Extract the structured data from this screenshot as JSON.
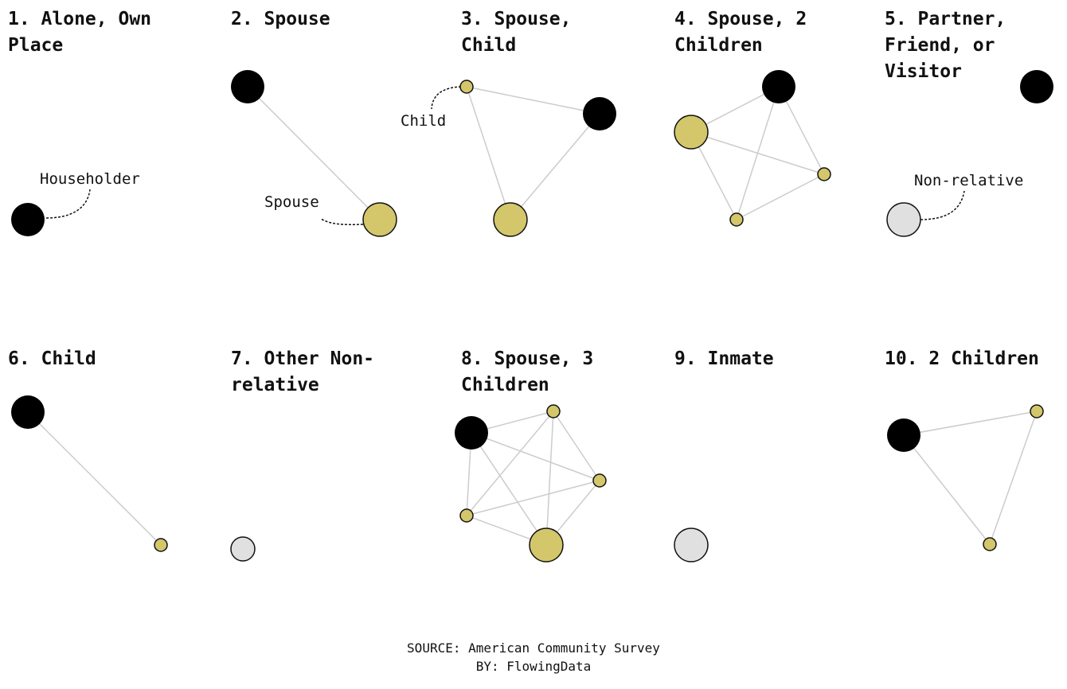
{
  "colors": {
    "householder": "#000000",
    "relative": "#d4c66a",
    "non_relative": "#e0e0e0",
    "stroke": "#111111",
    "edge": "#cccccc"
  },
  "panels": [
    {
      "title": "1. Alone, Own Place",
      "nodes": [
        {
          "role": "householder",
          "size": "large"
        }
      ],
      "edges": [],
      "annotation": {
        "label": "Householder",
        "target_node": 0
      }
    },
    {
      "title": "2. Spouse",
      "nodes": [
        {
          "role": "householder",
          "size": "large"
        },
        {
          "role": "relative",
          "size": "large"
        }
      ],
      "edges": [
        [
          0,
          1
        ]
      ],
      "annotation": {
        "label": "Spouse",
        "target_node": 1
      }
    },
    {
      "title": "3. Spouse, Child",
      "nodes": [
        {
          "role": "relative",
          "size": "small"
        },
        {
          "role": "householder",
          "size": "large"
        },
        {
          "role": "relative",
          "size": "large"
        }
      ],
      "edges": [
        [
          0,
          1
        ],
        [
          0,
          2
        ],
        [
          1,
          2
        ]
      ],
      "annotation": {
        "label": "Child",
        "target_node": 0
      }
    },
    {
      "title": "4. Spouse, 2 Children",
      "nodes": [
        {
          "role": "householder",
          "size": "large"
        },
        {
          "role": "relative",
          "size": "large"
        },
        {
          "role": "relative",
          "size": "small"
        },
        {
          "role": "relative",
          "size": "small"
        }
      ],
      "edges": [
        [
          0,
          1
        ],
        [
          0,
          2
        ],
        [
          0,
          3
        ],
        [
          1,
          2
        ],
        [
          1,
          3
        ],
        [
          2,
          3
        ]
      ],
      "annotation": null
    },
    {
      "title": "5. Partner, Friend, or Visitor",
      "nodes": [
        {
          "role": "householder",
          "size": "large"
        },
        {
          "role": "non_relative",
          "size": "large"
        }
      ],
      "edges": [],
      "annotation": {
        "label": "Non-relative",
        "target_node": 1
      }
    },
    {
      "title": "6. Child",
      "nodes": [
        {
          "role": "householder",
          "size": "large"
        },
        {
          "role": "relative",
          "size": "small"
        }
      ],
      "edges": [
        [
          0,
          1
        ]
      ],
      "annotation": null
    },
    {
      "title": "7. Other Non-relative",
      "nodes": [
        {
          "role": "non_relative",
          "size": "medium"
        }
      ],
      "edges": [],
      "annotation": null
    },
    {
      "title": "8. Spouse, 3 Children",
      "nodes": [
        {
          "role": "householder",
          "size": "large"
        },
        {
          "role": "relative",
          "size": "small"
        },
        {
          "role": "relative",
          "size": "small"
        },
        {
          "role": "relative",
          "size": "small"
        },
        {
          "role": "relative",
          "size": "large"
        }
      ],
      "edges": [
        [
          0,
          1
        ],
        [
          0,
          2
        ],
        [
          0,
          3
        ],
        [
          0,
          4
        ],
        [
          1,
          2
        ],
        [
          1,
          3
        ],
        [
          1,
          4
        ],
        [
          2,
          3
        ],
        [
          2,
          4
        ],
        [
          3,
          4
        ]
      ],
      "annotation": null
    },
    {
      "title": "9. Inmate",
      "nodes": [
        {
          "role": "non_relative",
          "size": "large"
        }
      ],
      "edges": [],
      "annotation": null
    },
    {
      "title": "10. 2 Children",
      "nodes": [
        {
          "role": "householder",
          "size": "large"
        },
        {
          "role": "relative",
          "size": "small"
        },
        {
          "role": "relative",
          "size": "small"
        }
      ],
      "edges": [
        [
          0,
          1
        ],
        [
          0,
          2
        ],
        [
          1,
          2
        ]
      ],
      "annotation": null
    }
  ],
  "footer": {
    "source": "SOURCE: American Community Survey",
    "byline": "BY: FlowingData"
  }
}
